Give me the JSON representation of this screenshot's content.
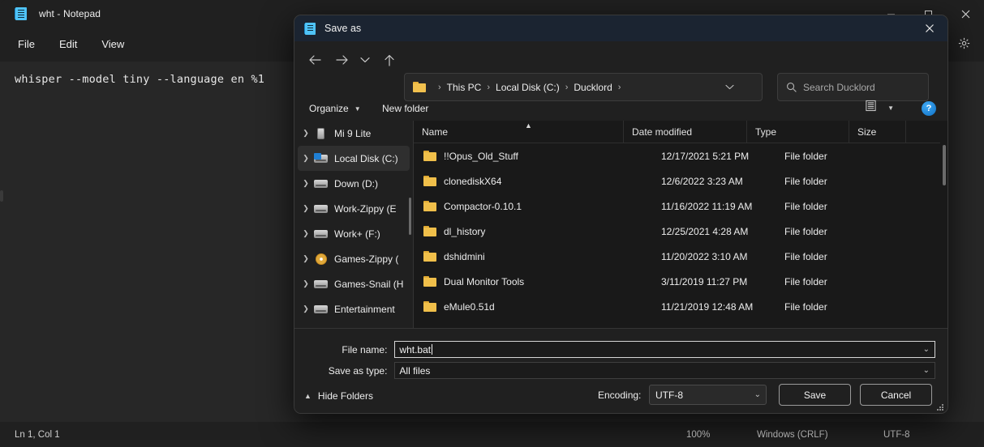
{
  "notepad": {
    "title": "wht - Notepad",
    "app_icon": "notepad-icon",
    "menus": [
      "File",
      "Edit",
      "View"
    ],
    "settings_icon": "gear-icon",
    "window_controls": [
      "minimize-icon",
      "maximize-icon",
      "close-icon"
    ],
    "text": "whisper --model tiny --language en %1",
    "status": {
      "position": "Ln 1, Col 1",
      "zoom": "100%",
      "line_endings": "Windows (CRLF)",
      "encoding": "UTF-8"
    }
  },
  "dialog": {
    "title": "Save as",
    "title_icon": "notepad-icon",
    "close_icon": "close-icon",
    "nav": {
      "back_icon": "arrow-left-icon",
      "forward_icon": "arrow-right-icon",
      "recent_icon": "chevron-down-icon",
      "up_icon": "arrow-up-icon",
      "refresh_icon": "refresh-icon",
      "address_icon": "folder-icon",
      "address_chevron_icon": "chevron-down-icon",
      "breadcrumbs": [
        "This PC",
        "Local Disk (C:)",
        "Ducklord"
      ]
    },
    "search": {
      "placeholder": "Search Ducklord",
      "icon": "search-icon"
    },
    "commandbar": {
      "organize": "Organize",
      "new_folder": "New folder",
      "view_icon": "list-view-icon",
      "view_caret_icon": "chevron-down-icon",
      "help_icon": "help-icon",
      "help_label": "?"
    },
    "sidebar": {
      "items": [
        {
          "label": "Mi 9 Lite",
          "icon": "phone-icon",
          "expand_icon": "chevron-right-icon",
          "selected": false
        },
        {
          "label": "Local Disk (C:)",
          "icon": "local-disk-icon",
          "expand_icon": "chevron-right-icon",
          "selected": true
        },
        {
          "label": "Down (D:)",
          "icon": "drive-icon",
          "expand_icon": "chevron-right-icon",
          "selected": false
        },
        {
          "label": "Work-Zippy (E",
          "icon": "drive-icon",
          "expand_icon": "chevron-right-icon",
          "selected": false
        },
        {
          "label": "Work+ (F:)",
          "icon": "drive-icon",
          "expand_icon": "chevron-right-icon",
          "selected": false
        },
        {
          "label": "Games-Zippy (",
          "icon": "disc-drive-icon",
          "expand_icon": "chevron-right-icon",
          "selected": false
        },
        {
          "label": "Games-Snail (H",
          "icon": "drive-icon",
          "expand_icon": "chevron-right-icon",
          "selected": false
        },
        {
          "label": "Entertainment",
          "icon": "drive-icon",
          "expand_icon": "chevron-right-icon",
          "selected": false
        }
      ]
    },
    "filelist": {
      "columns": [
        "Name",
        "Date modified",
        "Type",
        "Size"
      ],
      "sort_icon": "sort-ascending-icon",
      "rows": [
        {
          "name": "!!Opus_Old_Stuff",
          "date": "12/17/2021 5:21 PM",
          "type": "File folder",
          "size": "",
          "icon": "folder-icon"
        },
        {
          "name": "clonediskX64",
          "date": "12/6/2022 3:23 AM",
          "type": "File folder",
          "size": "",
          "icon": "folder-icon"
        },
        {
          "name": "Compactor-0.10.1",
          "date": "11/16/2022 11:19 AM",
          "type": "File folder",
          "size": "",
          "icon": "folder-icon"
        },
        {
          "name": "dl_history",
          "date": "12/25/2021 4:28 AM",
          "type": "File folder",
          "size": "",
          "icon": "folder-icon"
        },
        {
          "name": "dshidmini",
          "date": "11/20/2022 3:10 AM",
          "type": "File folder",
          "size": "",
          "icon": "folder-icon"
        },
        {
          "name": "Dual Monitor Tools",
          "date": "3/11/2019 11:27 PM",
          "type": "File folder",
          "size": "",
          "icon": "folder-icon"
        },
        {
          "name": "eMule0.51d",
          "date": "11/21/2019 12:48 AM",
          "type": "File folder",
          "size": "",
          "icon": "folder-icon"
        }
      ]
    },
    "form": {
      "filename_label": "File name:",
      "filename_value": "wht.bat",
      "savetype_label": "Save as type:",
      "savetype_value": "All files",
      "hide_folders": "Hide Folders",
      "hide_folders_icon": "chevron-up-icon",
      "encoding_label": "Encoding:",
      "encoding_value": "UTF-8",
      "save_button": "Save",
      "cancel_button": "Cancel",
      "dropdown_icon": "chevron-down-icon",
      "resize_grip_icon": "resize-grip-icon"
    }
  }
}
